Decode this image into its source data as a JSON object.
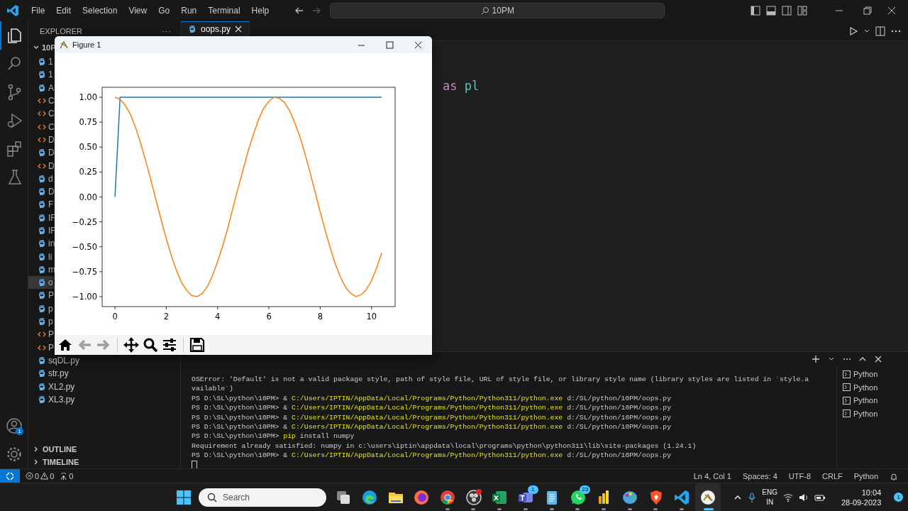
{
  "title_bar": {
    "menu": [
      "File",
      "Edit",
      "Selection",
      "View",
      "Go",
      "Run",
      "Terminal",
      "Help"
    ],
    "back_disabled": false,
    "forward_disabled": true,
    "search": "10PM"
  },
  "activity_bar": {
    "items": [
      {
        "kind": "files",
        "selected": true
      },
      {
        "kind": "search",
        "selected": false
      },
      {
        "kind": "source-control",
        "selected": false
      },
      {
        "kind": "run-debug",
        "selected": false
      },
      {
        "kind": "extensions",
        "selected": false
      },
      {
        "kind": "testing",
        "selected": false
      }
    ],
    "account_badge": "1"
  },
  "sidebar": {
    "title": "EXPLORER",
    "more": "···",
    "folder": "10P",
    "files": [
      {
        "name": "1",
        "kind": "python",
        "selected": false
      },
      {
        "name": "1",
        "kind": "python",
        "selected": false
      },
      {
        "name": "A",
        "kind": "python",
        "selected": false
      },
      {
        "name": "C",
        "kind": "html",
        "selected": false
      },
      {
        "name": "C",
        "kind": "html",
        "selected": false
      },
      {
        "name": "C",
        "kind": "html",
        "selected": false
      },
      {
        "name": "D",
        "kind": "html",
        "selected": false
      },
      {
        "name": "D",
        "kind": "python",
        "selected": false
      },
      {
        "name": "D",
        "kind": "html",
        "selected": false
      },
      {
        "name": "d",
        "kind": "python",
        "selected": false
      },
      {
        "name": "D",
        "kind": "python",
        "selected": false
      },
      {
        "name": "F",
        "kind": "python",
        "selected": false
      },
      {
        "name": "IF",
        "kind": "python",
        "selected": false
      },
      {
        "name": "IF",
        "kind": "python",
        "selected": false
      },
      {
        "name": "in",
        "kind": "python",
        "selected": false
      },
      {
        "name": "li",
        "kind": "python",
        "selected": false
      },
      {
        "name": "m",
        "kind": "python",
        "selected": false
      },
      {
        "name": "o",
        "kind": "python",
        "selected": true
      },
      {
        "name": "P",
        "kind": "python",
        "selected": false
      },
      {
        "name": "p",
        "kind": "python",
        "selected": false
      },
      {
        "name": "p",
        "kind": "python",
        "selected": false
      },
      {
        "name": "P",
        "kind": "html",
        "selected": false
      },
      {
        "name": "P",
        "kind": "html",
        "selected": false
      },
      {
        "name": "sqDL.py",
        "kind": "python",
        "selected": false
      },
      {
        "name": "str.py",
        "kind": "python",
        "selected": false
      },
      {
        "name": "XL2.py",
        "kind": "python",
        "selected": false
      },
      {
        "name": "XL3.py",
        "kind": "python",
        "selected": false
      }
    ],
    "sections": [
      "OUTLINE",
      "TIMELINE"
    ]
  },
  "editor": {
    "tab": {
      "label": "oops.py"
    },
    "code_line": {
      "keyword": "as",
      "name": "pl"
    }
  },
  "figure": {
    "title": "Figure 1",
    "chart_data": {
      "type": "line",
      "xlim": [
        -0.5,
        10.92
      ],
      "ylim": [
        -1.1,
        1.1
      ],
      "xticks": [
        0,
        2,
        4,
        6,
        8,
        10
      ],
      "yticks": [
        {
          "value": 1,
          "label": "1.00"
        },
        {
          "value": 0.75,
          "label": "0.75"
        },
        {
          "value": 0.5,
          "label": "0.50"
        },
        {
          "value": 0.25,
          "label": "0.25"
        },
        {
          "value": 0,
          "label": "0.00"
        },
        {
          "value": -0.25,
          "label": "−0.25"
        },
        {
          "value": -0.5,
          "label": "−0.50"
        },
        {
          "value": -0.75,
          "label": "−0.75"
        },
        {
          "value": -1,
          "label": "−1.00"
        }
      ],
      "x": [
        0,
        0.2,
        0.4,
        0.6,
        0.8,
        1,
        1.2,
        1.4,
        1.6,
        1.8,
        2,
        2.2,
        2.4,
        2.6,
        2.8,
        3,
        3.2,
        3.4,
        3.6,
        3.8,
        4,
        4.2,
        4.4,
        4.6,
        4.8,
        5,
        5.2,
        5.4,
        5.6,
        5.8,
        6,
        6.2,
        6.4,
        6.6,
        6.8,
        7,
        7.2,
        7.4,
        7.6,
        7.8,
        8,
        8.2,
        8.4,
        8.6,
        8.8,
        9,
        9.2,
        9.4,
        9.6,
        9.8,
        10,
        10.2,
        10.4
      ],
      "series": [
        {
          "color": "#1f77b4",
          "values": [
            0,
            1,
            1,
            1,
            1,
            1,
            1,
            1,
            1,
            1,
            1,
            1,
            1,
            1,
            1,
            1,
            1,
            1,
            1,
            1,
            1,
            1,
            1,
            1,
            1,
            1,
            1,
            1,
            1,
            1,
            1,
            1,
            1,
            1,
            1,
            1,
            1,
            1,
            1,
            1,
            1,
            1,
            1,
            1,
            1,
            1,
            1,
            1,
            1,
            1,
            1,
            1,
            1
          ]
        },
        {
          "color": "#ff7f0e",
          "values": [
            1,
            0.98,
            0.92,
            0.83,
            0.7,
            0.54,
            0.36,
            0.17,
            -0.03,
            -0.23,
            -0.42,
            -0.59,
            -0.74,
            -0.86,
            -0.94,
            -0.99,
            -1,
            -0.97,
            -0.9,
            -0.79,
            -0.65,
            -0.49,
            -0.31,
            -0.11,
            0.09,
            0.28,
            0.47,
            0.63,
            0.78,
            0.89,
            0.96,
            1,
            0.99,
            0.95,
            0.87,
            0.75,
            0.61,
            0.44,
            0.25,
            0.05,
            -0.15,
            -0.34,
            -0.52,
            -0.68,
            -0.81,
            -0.91,
            -0.97,
            -1,
            -0.98,
            -0.93,
            -0.84,
            -0.71,
            -0.56
          ]
        }
      ]
    },
    "tools": [
      {
        "kind": "home",
        "disabled": false
      },
      {
        "kind": "back",
        "disabled": true
      },
      {
        "kind": "forward",
        "disabled": true
      },
      {
        "kind": "pan",
        "disabled": false
      },
      {
        "kind": "zoom",
        "disabled": false
      },
      {
        "kind": "configure",
        "disabled": false
      },
      {
        "kind": "save",
        "disabled": false
      }
    ]
  },
  "terminal": {
    "lines": [
      {
        "kind": "output",
        "text": "OSError: 'Default' is not a valid package style, path of style file, URL of style file, or library style name (library styles are listed in `style.a"
      },
      {
        "kind": "output",
        "text": "vailable`)"
      },
      {
        "kind": "command",
        "prompt": "PS D:\\SL\\python\\10PM>",
        "operator": "&",
        "program": "C:/Users/IPTIN/AppData/Local/Programs/Python/Python311/python.exe",
        "args": "d:/SL/python/10PM/oops.py"
      },
      {
        "kind": "command",
        "prompt": "PS D:\\SL\\python\\10PM>",
        "operator": "&",
        "program": "C:/Users/IPTIN/AppData/Local/Programs/Python/Python311/python.exe",
        "args": "d:/SL/python/10PM/oops.py"
      },
      {
        "kind": "command",
        "prompt": "PS D:\\SL\\python\\10PM>",
        "operator": "&",
        "program": "C:/Users/IPTIN/AppData/Local/Programs/Python/Python311/python.exe",
        "args": "d:/SL/python/10PM/oops.py"
      },
      {
        "kind": "command",
        "prompt": "PS D:\\SL\\python\\10PM>",
        "operator": "&",
        "program": "C:/Users/IPTIN/AppData/Local/Programs/Python/Python311/python.exe",
        "args": "d:/SL/python/10PM/oops.py"
      },
      {
        "kind": "command",
        "prompt": "PS D:\\SL\\python\\10PM>",
        "program": "pip",
        "args": "install numpy"
      },
      {
        "kind": "output",
        "text": "Requirement already satisfied: numpy in c:\\users\\iptin\\appdata\\local\\programs\\python\\python311\\lib\\site-packages (1.24.1)"
      },
      {
        "kind": "command",
        "prompt": "PS D:\\SL\\python\\10PM>",
        "operator": "&",
        "program": "C:/Users/IPTIN/AppData/Local/Programs/Python/Python311/python.exe",
        "args": "d:/SL/python/10PM/oops.py"
      },
      {
        "kind": "cursor"
      }
    ],
    "sessions": [
      "Python",
      "Python",
      "Python",
      "Python"
    ]
  },
  "status_bar": {
    "errors": "0",
    "warnings": "0",
    "ports": "0",
    "right": [
      "Ln 4, Col 1",
      "Spaces: 4",
      "UTF-8",
      "CRLF",
      "Python"
    ]
  },
  "taskbar": {
    "search_placeholder": "Search",
    "apps": [
      {
        "kind": "task-view",
        "running": false,
        "active": false
      },
      {
        "kind": "edge",
        "running": false,
        "active": false
      },
      {
        "kind": "folder",
        "running": false,
        "active": false
      },
      {
        "kind": "firefox",
        "running": false,
        "active": false
      },
      {
        "kind": "chrome",
        "running": true,
        "active": false
      },
      {
        "kind": "recorder",
        "running": true,
        "active": false
      },
      {
        "kind": "excel",
        "running": true,
        "active": false
      },
      {
        "kind": "teams",
        "badge": "1",
        "running": true,
        "active": false
      },
      {
        "kind": "notepad",
        "running": true,
        "active": false
      },
      {
        "kind": "whatsapp",
        "badge": "23",
        "running": true,
        "active": false
      },
      {
        "kind": "powerbi",
        "running": true,
        "active": false
      },
      {
        "kind": "paint",
        "running": true,
        "active": false
      },
      {
        "kind": "brave",
        "running": true,
        "active": false
      },
      {
        "kind": "vscode",
        "running": true,
        "active": false
      },
      {
        "kind": "figure",
        "running": true,
        "active": true
      }
    ],
    "language": [
      "ENG",
      "IN"
    ],
    "time": "10:04",
    "date": "28-09-2023",
    "notifications": "1"
  }
}
